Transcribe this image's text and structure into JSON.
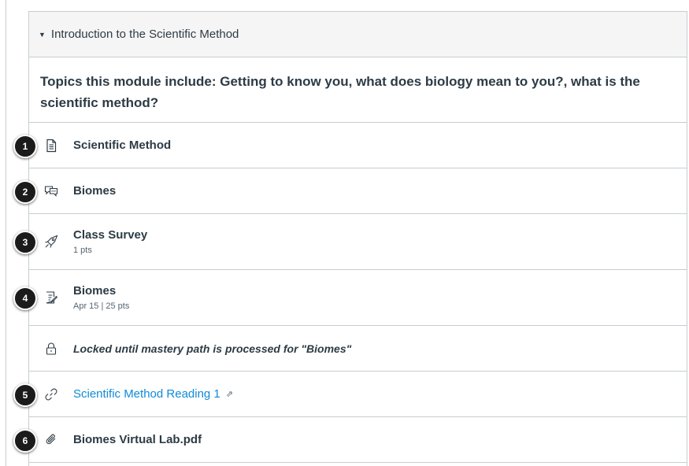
{
  "module": {
    "title": "Introduction to the Scientific Method",
    "description": "Topics this module include: Getting to know you, what does biology mean to you?, what is the scientific method?",
    "items": [
      {
        "badge": "1",
        "icon": "page-icon",
        "title": "Scientific Method",
        "meta": ""
      },
      {
        "badge": "2",
        "icon": "discussion-icon",
        "title": "Biomes",
        "meta": ""
      },
      {
        "badge": "3",
        "icon": "quiz-icon",
        "title": "Class Survey",
        "meta": "1 pts"
      },
      {
        "badge": "4",
        "icon": "assignment-icon",
        "title": "Biomes",
        "meta": "Apr 15 | 25 pts"
      },
      {
        "badge": "",
        "icon": "lock-icon",
        "title": "Locked until mastery path is processed for \"Biomes\"",
        "meta": ""
      },
      {
        "badge": "5",
        "icon": "link-icon",
        "title": "Scientific Method Reading 1",
        "meta": ""
      },
      {
        "badge": "6",
        "icon": "attachment-icon",
        "title": "Biomes Virtual Lab.pdf",
        "meta": ""
      }
    ]
  },
  "colors": {
    "link": "#0e8ad8",
    "text": "#2d3b45",
    "border": "#c7cdd1",
    "header_bg": "#f5f5f5",
    "badge": "#1b1b1b"
  }
}
